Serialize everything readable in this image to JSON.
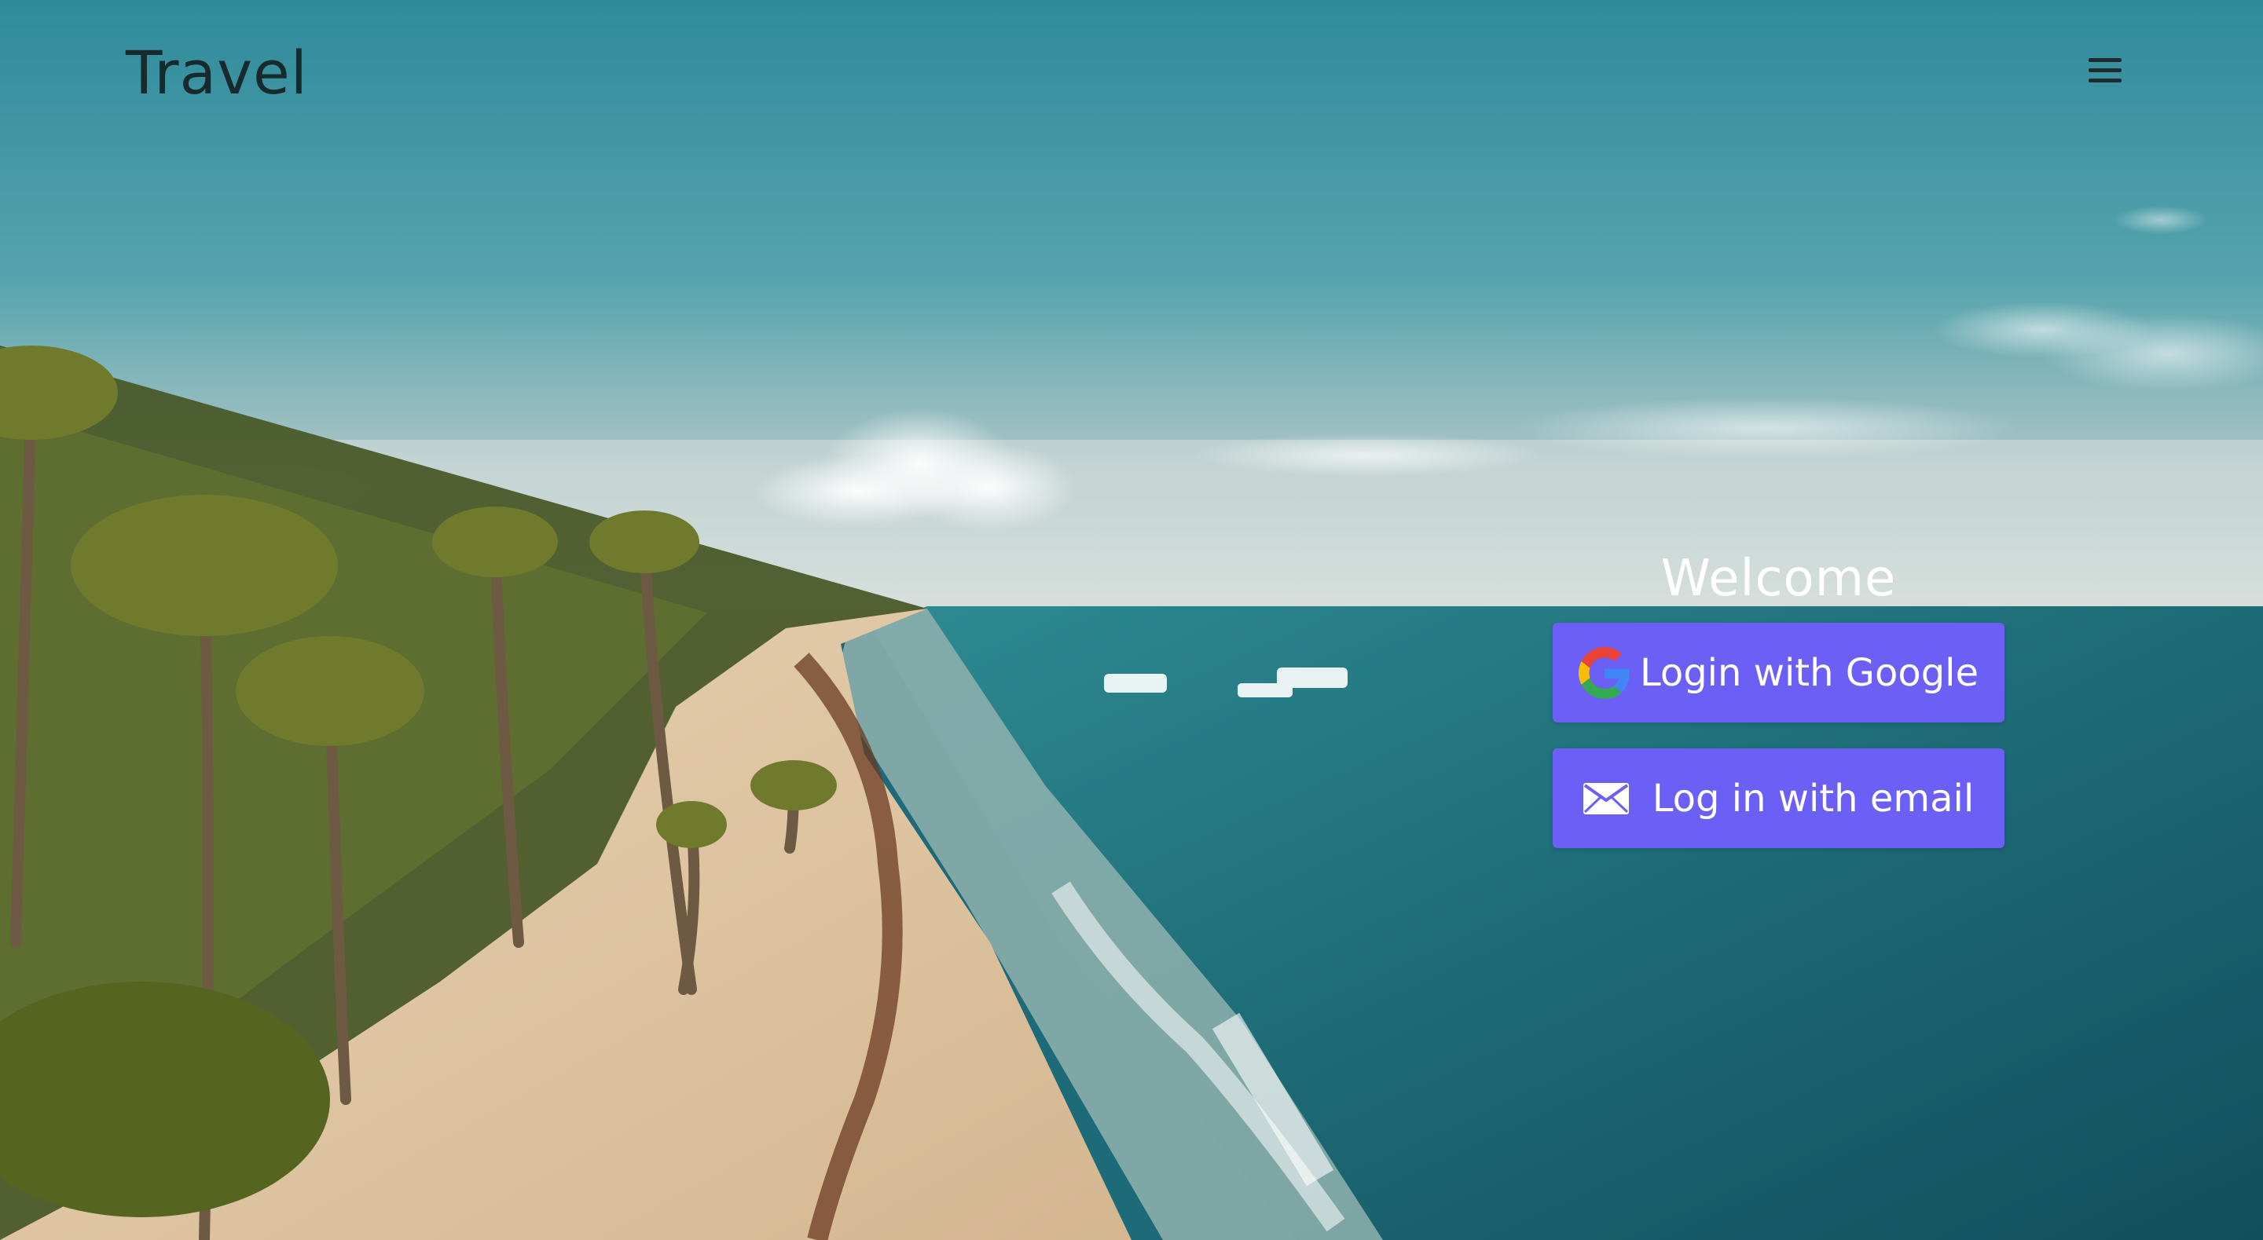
{
  "header": {
    "brand": "Travel",
    "menu_icon": "hamburger-menu-icon"
  },
  "auth": {
    "welcome": "Welcome",
    "google_label": "Login with Google",
    "email_label": "Log in with email",
    "google_icon": "google-logo-icon",
    "email_icon": "envelope-icon"
  },
  "colors": {
    "button": "#6b5ff5",
    "button_text": "#ffffff",
    "brand_text": "#172b2f",
    "welcome_text": "#ffffff"
  },
  "background": {
    "scene": "aerial-beach-background"
  }
}
